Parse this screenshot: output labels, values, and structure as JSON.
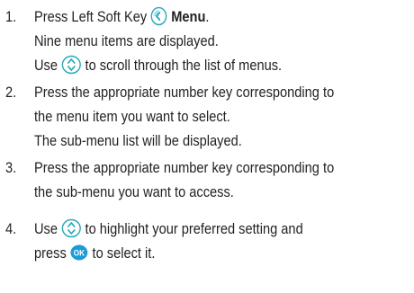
{
  "steps": [
    {
      "number": "1.",
      "line1_pre": "Press Left Soft Key",
      "line1_bold": "Menu",
      "line1_post": ".",
      "line2": "Nine menu items are displayed.",
      "line3_pre": "Use",
      "line3_post": "to scroll through the list of menus."
    },
    {
      "number": "2.",
      "line1": "Press the appropriate number key corresponding to",
      "line2": "the menu item you want to select.",
      "line3": "The sub-menu list will be displayed."
    },
    {
      "number": "3.",
      "line1": "Press the appropriate number key corresponding to",
      "line2": "the sub-menu you want to access."
    },
    {
      "number": "4.",
      "line1_pre": "Use",
      "line1_post": "to highlight your preferred setting and",
      "line2_pre": "press",
      "line2_post": "to select it."
    }
  ],
  "icons": {
    "left_soft_key": "left-soft-key-icon",
    "nav_key": "navigation-key-icon",
    "ok_key": "ok-key-icon",
    "ok_label": "OK"
  },
  "colors": {
    "text": "#231f20",
    "icon_teal": "#2aa7b8",
    "icon_blue": "#1d9bd7"
  }
}
